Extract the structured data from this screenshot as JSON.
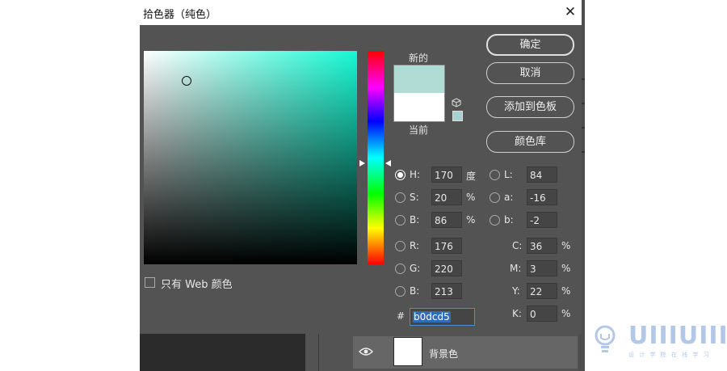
{
  "dialog": {
    "title": "拾色器（纯色）",
    "close_glyph": "✕"
  },
  "swatches": {
    "new_label": "新的",
    "current_label": "当前",
    "new_color": "#b0dcd5",
    "current_color": "#ffffff"
  },
  "buttons": {
    "ok": "确定",
    "cancel": "取消",
    "add_to_swatches": "添加到色板",
    "color_libraries": "颜色库"
  },
  "fields": {
    "H": {
      "label": "H:",
      "value": "170",
      "unit": "度",
      "checked": true
    },
    "S": {
      "label": "S:",
      "value": "20",
      "unit": "%"
    },
    "Bv": {
      "label": "B:",
      "value": "86",
      "unit": "%"
    },
    "R": {
      "label": "R:",
      "value": "176"
    },
    "G": {
      "label": "G:",
      "value": "220"
    },
    "Bc": {
      "label": "B:",
      "value": "213"
    },
    "L": {
      "label": "L:",
      "value": "84"
    },
    "a": {
      "label": "a:",
      "value": "-16"
    },
    "b": {
      "label": "b:",
      "value": "-2"
    },
    "C": {
      "label": "C:",
      "value": "36",
      "unit": "%"
    },
    "M": {
      "label": "M:",
      "value": "3",
      "unit": "%"
    },
    "Y": {
      "label": "Y:",
      "value": "22",
      "unit": "%"
    },
    "K": {
      "label": "K:",
      "value": "0",
      "unit": "%"
    }
  },
  "hex": {
    "hash": "#",
    "value": "b0dcd5"
  },
  "web_only": {
    "label": "只有 Web 颜色",
    "checked": false
  },
  "layer": {
    "name": "背景色"
  },
  "watermark": {
    "brand": "UIIIUIII",
    "tagline": "设 计 学 院 在 线 学 习"
  },
  "colors": {
    "hue_base": "#16f9d3",
    "accent": "#4a90d9"
  }
}
